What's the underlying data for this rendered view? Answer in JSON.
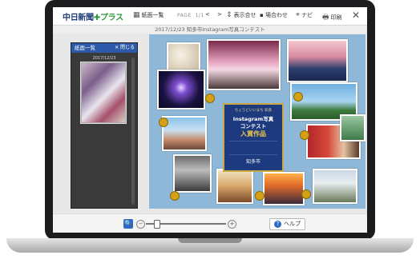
{
  "toolbar": {
    "logo_main": "中日新聞",
    "logo_plus": "✚プラス",
    "view_all": "紙面一覧",
    "page_label": "PAGE",
    "page_value": "1/1",
    "prev_icon": "<",
    "next_icon": ">",
    "scroll_label": "表示合せ",
    "fit_label": "▪ 場合わせ",
    "nav_label": "ナビ",
    "print_label": "印刷",
    "close_icon": "✕"
  },
  "subtitle": "2017/12/23 知多市Instagram写真コンテスト",
  "panel": {
    "title": "紙面一覧",
    "close_label": "✕ 閉じる",
    "date": "2017/12/23"
  },
  "card": {
    "sub": "ちょうどいいまち 知多",
    "title_line1": "Instagram写真",
    "title_line2": "コンテスト",
    "award": "入賞作品",
    "city": "知多市"
  },
  "bottom": {
    "search_icon": "🔍",
    "zoom_minus": "−",
    "zoom_plus": "+",
    "zoom_level": 0.12,
    "help_label": "ヘルプ",
    "help_icon": "?"
  },
  "colors": {
    "brand_blue": "#1e3c78",
    "accent_blue": "#2d6cc4",
    "plus_green": "#2a9a3a"
  }
}
